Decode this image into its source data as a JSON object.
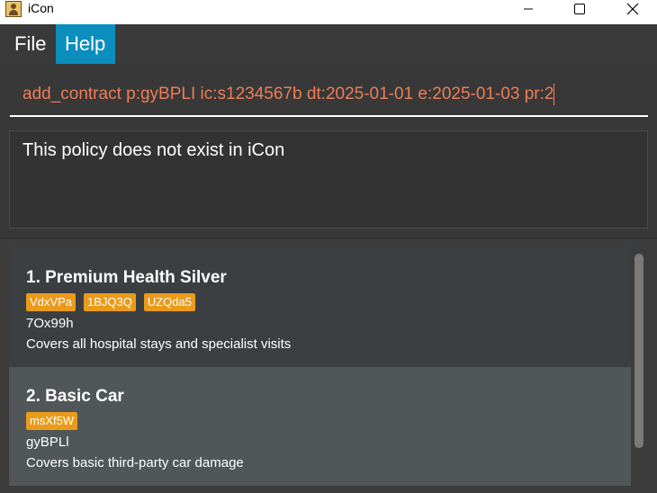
{
  "window": {
    "title": "iCon"
  },
  "menu": {
    "file": "File",
    "help": "Help"
  },
  "command": {
    "value": "add_contract p:gyBPLI ic:s1234567b dt:2025-01-01 e:2025-01-03 pr:2"
  },
  "result": {
    "message": "This policy does not exist in iCon"
  },
  "policies": [
    {
      "title": "1. Premium Health Silver",
      "tags": [
        "VdxVPa",
        "1BJQ3Q",
        "UZQda5"
      ],
      "id": "7Ox99h",
      "description": "Covers all hospital stays and specialist visits"
    },
    {
      "title": "2. Basic Car",
      "tags": [
        "msXf5W"
      ],
      "id": "gyBPLl",
      "description": "Covers basic third-party car damage"
    }
  ],
  "colors": {
    "accent": "#0b8ebd",
    "command_text": "#ef7e57",
    "tag": "#ea9b1a",
    "background": "#383838"
  }
}
